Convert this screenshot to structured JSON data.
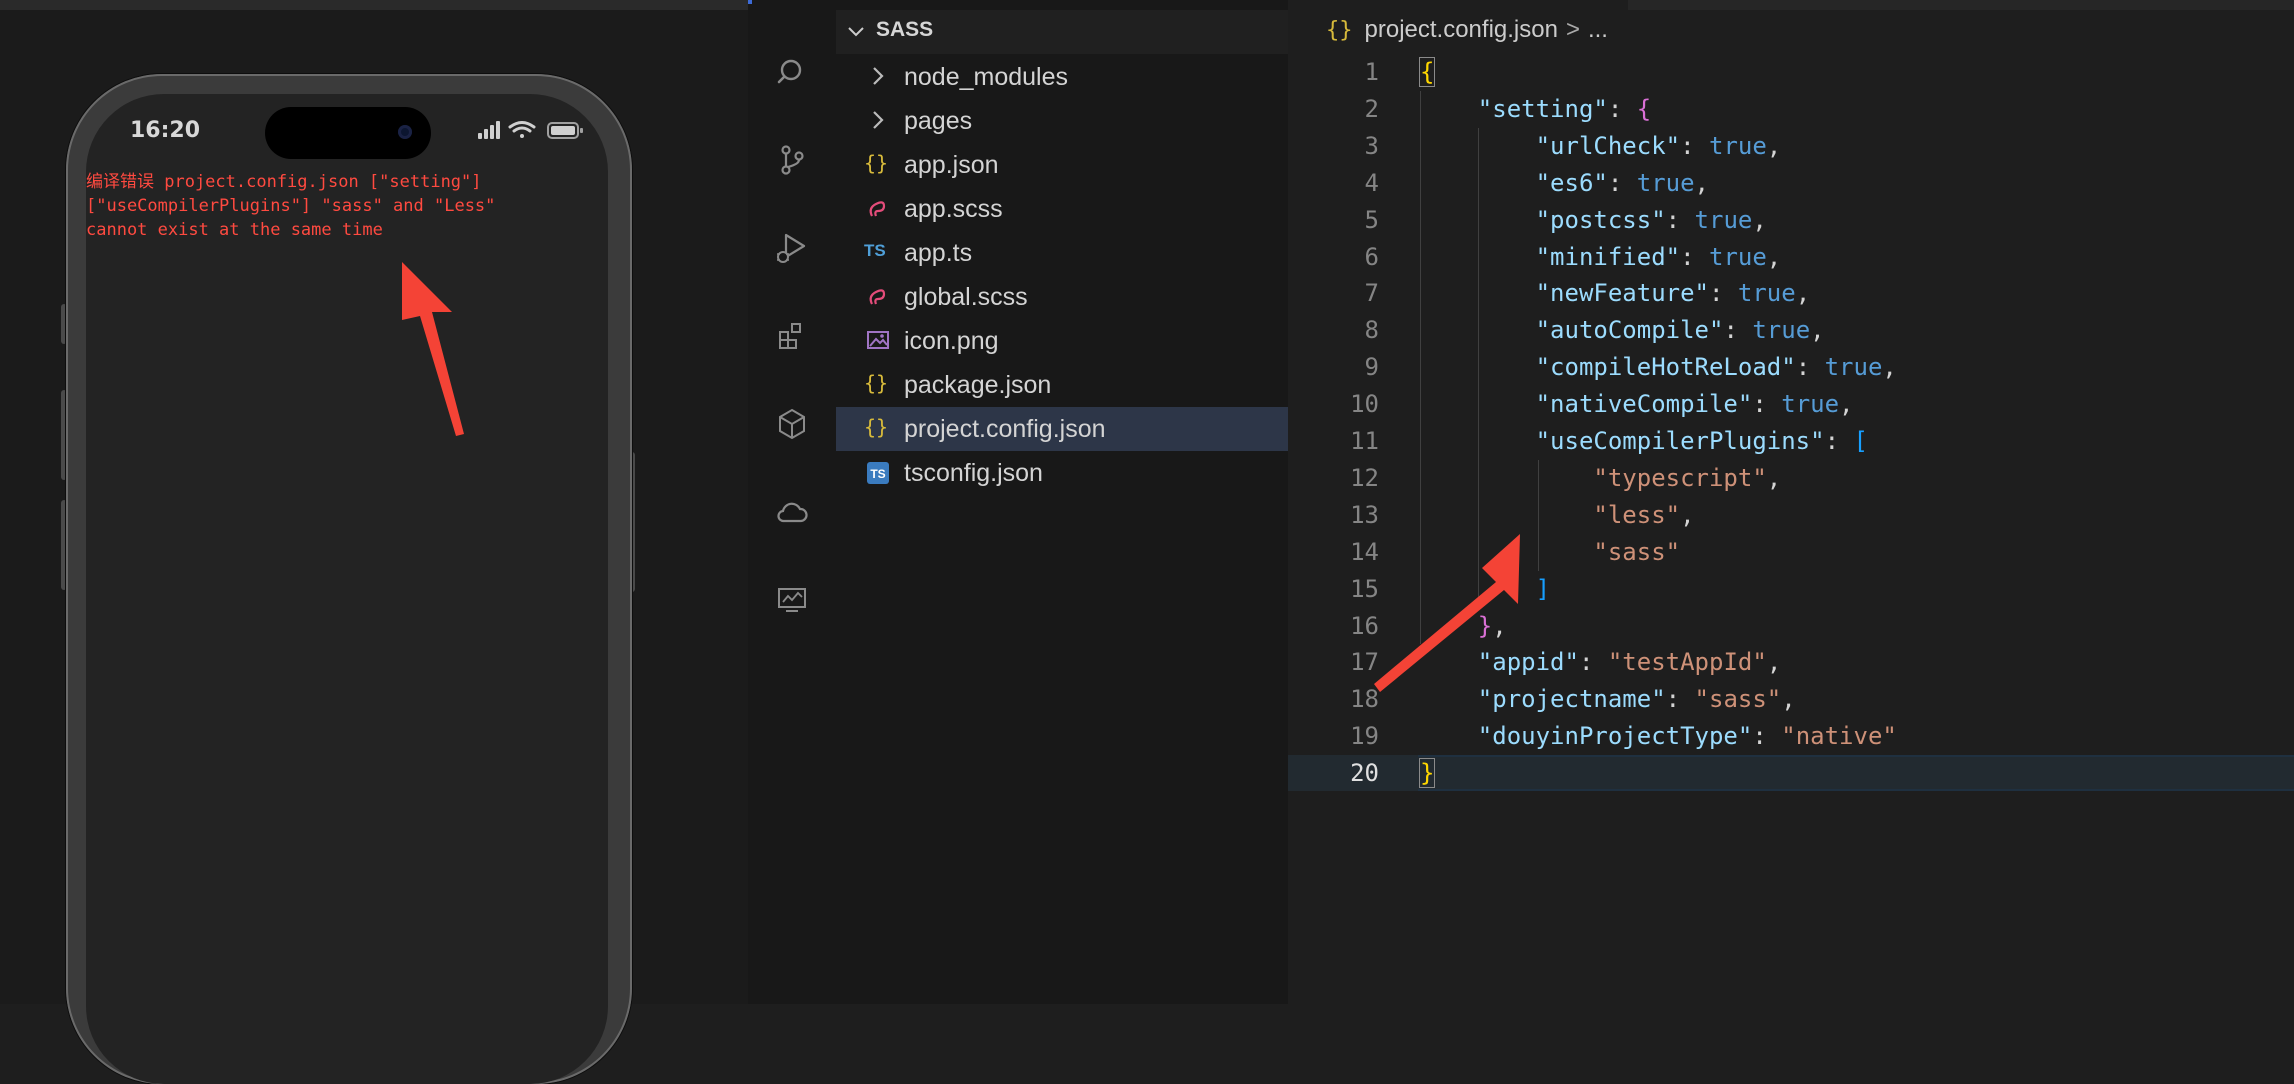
{
  "simulator": {
    "time": "16:20",
    "error_message": "编译错误 project.config.json [\"setting\"]\n[\"useCompilerPlugins\"] \"sass\" and \"Less\"\ncannot exist at the same time"
  },
  "activity_bar": {
    "icons": [
      "search-icon",
      "source-control-icon",
      "run-debug-icon",
      "extensions-icon",
      "package-icon",
      "cloud-icon",
      "monitor-icon"
    ]
  },
  "explorer": {
    "root": "SASS",
    "items": [
      {
        "label": "node_modules",
        "kind": "folder"
      },
      {
        "label": "pages",
        "kind": "folder"
      },
      {
        "label": "app.json",
        "kind": "json"
      },
      {
        "label": "app.scss",
        "kind": "scss"
      },
      {
        "label": "app.ts",
        "kind": "ts",
        "badge": "TS"
      },
      {
        "label": "global.scss",
        "kind": "scss"
      },
      {
        "label": "icon.png",
        "kind": "image"
      },
      {
        "label": "package.json",
        "kind": "json"
      },
      {
        "label": "project.config.json",
        "kind": "json",
        "selected": true
      },
      {
        "label": "tsconfig.json",
        "kind": "tsconfig",
        "badge": "TS"
      }
    ]
  },
  "editor": {
    "breadcrumb_icon": "{}",
    "breadcrumb_file": "project.config.json",
    "breadcrumb_sep": ">",
    "breadcrumb_rest": "...",
    "current_line": 20,
    "lines": [
      {
        "n": "1",
        "text": "{"
      },
      {
        "n": "2",
        "text": "    \"setting\": {"
      },
      {
        "n": "3",
        "text": "        \"urlCheck\": true,"
      },
      {
        "n": "4",
        "text": "        \"es6\": true,"
      },
      {
        "n": "5",
        "text": "        \"postcss\": true,"
      },
      {
        "n": "6",
        "text": "        \"minified\": true,"
      },
      {
        "n": "7",
        "text": "        \"newFeature\": true,"
      },
      {
        "n": "8",
        "text": "        \"autoCompile\": true,"
      },
      {
        "n": "9",
        "text": "        \"compileHotReLoad\": true,"
      },
      {
        "n": "10",
        "text": "        \"nativeCompile\": true,"
      },
      {
        "n": "11",
        "text": "        \"useCompilerPlugins\": ["
      },
      {
        "n": "12",
        "text": "            \"typescript\","
      },
      {
        "n": "13",
        "text": "            \"less\","
      },
      {
        "n": "14",
        "text": "            \"sass\""
      },
      {
        "n": "15",
        "text": "        ]"
      },
      {
        "n": "16",
        "text": "    },"
      },
      {
        "n": "17",
        "text": "    \"appid\": \"testAppId\","
      },
      {
        "n": "18",
        "text": "    \"projectname\": \"sass\","
      },
      {
        "n": "19",
        "text": "    \"douyinProjectType\": \"native\""
      },
      {
        "n": "20",
        "text": "}"
      }
    ]
  },
  "colors": {
    "error_red": "#ff4a40",
    "annotation_arrow": "#f44336",
    "selection_bg": "#2d3648",
    "json_key": "#9cdcfe",
    "json_string": "#ce9178",
    "json_bool": "#569cd6"
  }
}
